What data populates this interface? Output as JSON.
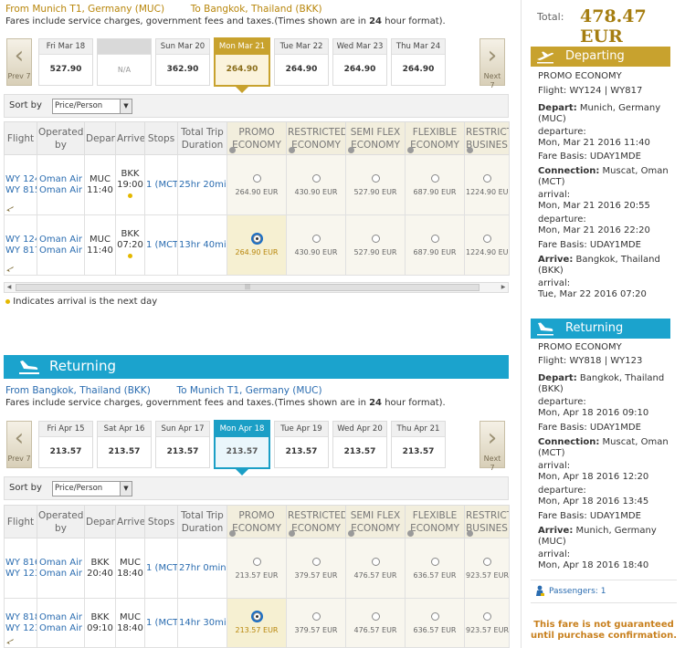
{
  "outbound": {
    "route_from": "From Munich T1, Germany (MUC)",
    "route_to": "To Bangkok, Thailand (BKK)",
    "fares_note_a": "Fares include service charges, government fees and taxes.(Times shown are in ",
    "fares_note_b": "24",
    "fares_note_c": " hour format).",
    "prev_label": "Prev 7",
    "next_label": "Next 7",
    "days": [
      {
        "label": "Fri Mar 18",
        "price": "527.90 EUR"
      },
      {
        "label": "",
        "price": "N/A"
      },
      {
        "label": "Sun Mar 20",
        "price": "362.90 EUR"
      },
      {
        "label": "Mon Mar 21",
        "price": "264.90 EUR"
      },
      {
        "label": "Tue Mar 22",
        "price": "264.90 EUR"
      },
      {
        "label": "Wed Mar 23",
        "price": "264.90 EUR"
      },
      {
        "label": "Thu Mar 24",
        "price": "264.90 EUR"
      }
    ],
    "sort_label": "Sort by",
    "sort_value": "Price/Person",
    "rows": [
      {
        "flight1": "WY 124",
        "flight2": "WY 815",
        "op1": "Oman Air",
        "op2": "Oman Air",
        "dep_code": "MUC",
        "dep_time": "11:40",
        "arr_code": "BKK",
        "arr_time": "19:00",
        "stops": "1 (MCT)",
        "duration": "25hr 20min",
        "fares": [
          "264.90 EUR",
          "430.90 EUR",
          "527.90 EUR",
          "687.90 EUR",
          "1224.90 EUR"
        ]
      },
      {
        "flight1": "WY 124",
        "flight2": "WY 817",
        "op1": "Oman Air",
        "op2": "Oman Air",
        "dep_code": "MUC",
        "dep_time": "11:40",
        "arr_code": "BKK",
        "arr_time": "07:20",
        "stops": "1 (MCT)",
        "duration": "13hr 40min",
        "fares": [
          "264.90 EUR",
          "430.90 EUR",
          "527.90 EUR",
          "687.90 EUR",
          "1224.90 EUR"
        ]
      }
    ]
  },
  "headers": {
    "flight": "Flight",
    "operated_1": "Operated",
    "operated_2": "by",
    "depart": "Depart",
    "arrive": "Arrive",
    "stops": "Stops",
    "duration_1": "Total Trip",
    "duration_2": "Duration",
    "fares": [
      {
        "l1": "PROMO",
        "l2": "ECONOMY"
      },
      {
        "l1": "RESTRICTED",
        "l2": "ECONOMY"
      },
      {
        "l1": "SEMI FLEX",
        "l2": "ECONOMY"
      },
      {
        "l1": "FLEXIBLE",
        "l2": "ECONOMY"
      },
      {
        "l1": "RESTRICTE",
        "l2": "BUSINES"
      }
    ]
  },
  "next_day_note": "Indicates arrival is the next day",
  "returning": {
    "banner": "Returning",
    "route_from": "From Bangkok, Thailand (BKK)",
    "route_to": "To Munich T1, Germany (MUC)",
    "fares_note_a": "Fares include service charges, government fees and taxes.(Times shown are in ",
    "fares_note_b": "24",
    "fares_note_c": " hour format).",
    "prev_label": "Prev 7",
    "next_label": "Next 7",
    "days": [
      {
        "label": "Fri Apr 15",
        "price": "213.57 EUR"
      },
      {
        "label": "Sat Apr 16",
        "price": "213.57 EUR"
      },
      {
        "label": "Sun Apr 17",
        "price": "213.57 EUR"
      },
      {
        "label": "Mon Apr 18",
        "price": "213.57 EUR"
      },
      {
        "label": "Tue Apr 19",
        "price": "213.57 EUR"
      },
      {
        "label": "Wed Apr 20",
        "price": "213.57 EUR"
      },
      {
        "label": "Thu Apr 21",
        "price": "213.57 EUR"
      }
    ],
    "sort_label": "Sort by",
    "sort_value": "Price/Person",
    "rows": [
      {
        "flight1": "WY 816",
        "flight2": "WY 123",
        "op1": "Oman Air",
        "op2": "Oman Air",
        "dep_code": "BKK",
        "dep_time": "20:40",
        "arr_code": "MUC",
        "arr_time": "18:40",
        "stops": "1 (MCT)",
        "duration": "27hr 0min",
        "fares": [
          "213.57 EUR",
          "379.57 EUR",
          "476.57 EUR",
          "636.57 EUR",
          "923.57 EUR"
        ]
      },
      {
        "flight1": "WY 818",
        "flight2": "WY 123",
        "op1": "Oman Air",
        "op2": "Oman Air",
        "dep_code": "BKK",
        "dep_time": "09:10",
        "arr_code": "MUC",
        "arr_time": "18:40",
        "stops": "1 (MCT)",
        "duration": "14hr 30min",
        "fares": [
          "213.57 EUR",
          "379.57 EUR",
          "476.57 EUR",
          "636.57 EUR",
          "923.57 EUR"
        ]
      }
    ]
  },
  "summary": {
    "total_label": "Total:",
    "total_value": "478.47 EUR",
    "departing": {
      "title": "Departing",
      "cabin": "PROMO ECONOMY",
      "flight": "Flight: WY124 | WY817",
      "depart_label": "Depart:",
      "depart_value": "Munich, Germany",
      "depart_code": "(MUC)",
      "departure_label": "departure:",
      "departure_value": "Mon, Mar 21 2016 11:40",
      "fare_basis_1": "Fare Basis: UDAY1MDE",
      "connection_label": "Connection:",
      "connection_value": "Muscat, Oman",
      "connection_code": "(MCT)",
      "arrival_label_1": "arrival:",
      "arrival_value_1": "Mon, Mar 21 2016 20:55",
      "departure_label_2": "departure:",
      "departure_value_2": "Mon, Mar 21 2016 22:20",
      "fare_basis_2": "Fare Basis: UDAY1MDE",
      "arrive_label": "Arrive:",
      "arrive_value": "Bangkok, Thailand",
      "arrive_code": "(BKK)",
      "arrival_label_2": "arrival:",
      "arrival_value_2": "Tue, Mar 22 2016 07:20"
    },
    "returning": {
      "title": "Returning",
      "cabin": "PROMO ECONOMY",
      "flight": "Flight: WY818 | WY123",
      "depart_label": "Depart:",
      "depart_value": "Bangkok, Thailand",
      "depart_code": "(BKK)",
      "departure_label": "departure:",
      "departure_value": "Mon, Apr 18 2016 09:10",
      "fare_basis_1": "Fare Basis: UDAY1MDE",
      "connection_label": "Connection:",
      "connection_value": "Muscat, Oman",
      "connection_code": "(MCT)",
      "arrival_label_1": "arrival:",
      "arrival_value_1": "Mon, Apr 18 2016 12:20",
      "departure_label_2": "departure:",
      "departure_value_2": "Mon, Apr 18 2016 13:45",
      "fare_basis_2": "Fare Basis: UDAY1MDE",
      "arrive_label": "Arrive:",
      "arrive_value": "Munich, Germany",
      "arrive_code": "(MUC)",
      "arrival_label_2": "arrival:",
      "arrival_value_2": "Mon, Apr 18 2016 18:40"
    },
    "passengers": "Passengers: 1",
    "guarantee_1": "This fare is not guaranteed",
    "guarantee_2": "until purchase confirmation."
  },
  "colors": {
    "gold": "#c8a22e",
    "teal": "#1ba3cd",
    "link_blue": "#2a6cb0",
    "price_gold": "#b8860b",
    "warning_orange": "#c8801e"
  },
  "icons": {
    "departing": "plane-takeoff-icon",
    "returning": "plane-landing-icon",
    "passenger": "person-icon",
    "prev": "chevron-left-icon",
    "next": "chevron-right-icon"
  }
}
